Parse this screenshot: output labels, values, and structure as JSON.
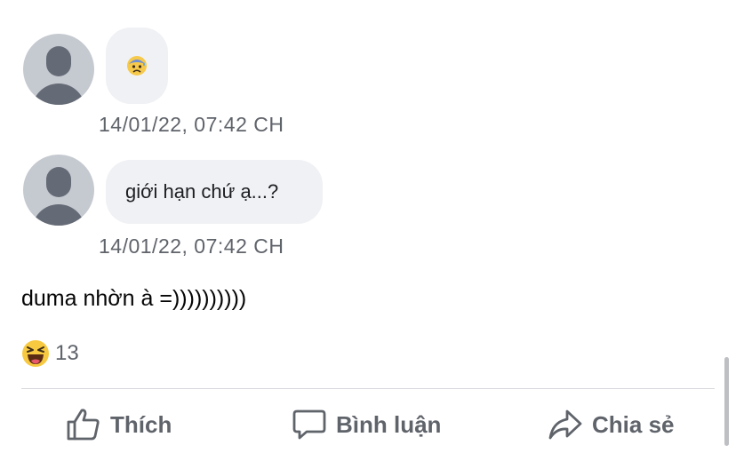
{
  "messages": [
    {
      "avatar": "default-avatar",
      "content_emoji": "anxious-face-with-sweat",
      "timestamp": "14/01/22, 07:42 CH"
    },
    {
      "avatar": "default-avatar",
      "content_text": "giới hạn chứ ạ...?",
      "timestamp": "14/01/22, 07:42 CH"
    }
  ],
  "comment": {
    "text": "duma nhờn à =))))))))))"
  },
  "reactions": {
    "icon": "haha-reaction-icon",
    "count": "13"
  },
  "actions": {
    "like_label": "Thích",
    "comment_label": "Bình luận",
    "share_label": "Chia sẻ"
  },
  "colors": {
    "bubble_bg": "#f0f1f4",
    "muted_text": "#5f636a",
    "avatar_bg": "#c5c9d0",
    "avatar_fg": "#656b76"
  }
}
